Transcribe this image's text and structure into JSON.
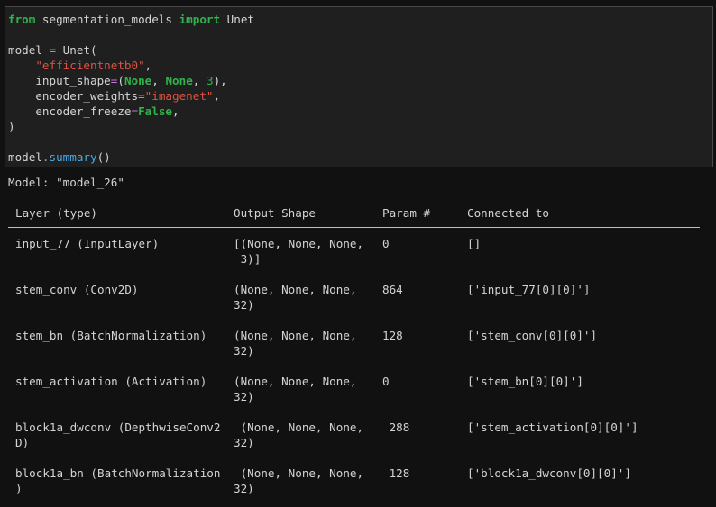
{
  "code": {
    "l1": {
      "kw1": "from",
      "mod": " segmentation_models ",
      "kw2": "import",
      "name": " Unet"
    },
    "l3": {
      "var": "model ",
      "eq": "=",
      "call": " Unet("
    },
    "l4": {
      "str": "\"efficientnetb0\"",
      "comma": ","
    },
    "l5": {
      "arg": "input_shape",
      "eq": "=",
      "p1": "(",
      "n1": "None",
      "c1": ", ",
      "n2": "None",
      "c2": ", ",
      "n3": "3",
      "p2": "),"
    },
    "l6": {
      "arg": "encoder_weights",
      "eq": "=",
      "str": "\"imagenet\"",
      "comma": ","
    },
    "l7": {
      "arg": "encoder_freeze",
      "eq": "=",
      "val": "False",
      "comma": ","
    },
    "l8": ")",
    "l10": {
      "obj": "model",
      "dot": ".",
      "fn": "summary",
      "paren": "()"
    }
  },
  "output": {
    "model_line": "Model: \"model_26\"",
    "headers": [
      "Layer (type)",
      "Output Shape",
      "Param #",
      "Connected to"
    ],
    "rows": [
      {
        "layer": [
          "input_77 (InputLayer)"
        ],
        "shape": [
          "[(None, None, None,",
          " 3)]"
        ],
        "param": "0",
        "conn": "[]"
      },
      {
        "layer": [
          "stem_conv (Conv2D)"
        ],
        "shape": [
          "(None, None, None,",
          "32)"
        ],
        "param": "864",
        "conn": "['input_77[0][0]']"
      },
      {
        "layer": [
          "stem_bn (BatchNormalization)"
        ],
        "shape": [
          "(None, None, None,",
          "32)"
        ],
        "param": "128",
        "conn": "['stem_conv[0][0]']"
      },
      {
        "layer": [
          "stem_activation (Activation)"
        ],
        "shape": [
          "(None, None, None,",
          "32)"
        ],
        "param": "0",
        "conn": "['stem_bn[0][0]']"
      },
      {
        "layer": [
          "block1a_dwconv (DepthwiseConv2",
          "D)"
        ],
        "shape": [
          " (None, None, None,",
          "32)"
        ],
        "param": " 288",
        "conn": "['stem_activation[0][0]']"
      },
      {
        "layer": [
          "block1a_bn (BatchNormalization",
          ")"
        ],
        "shape": [
          " (None, None, None,",
          "32)"
        ],
        "param": " 128",
        "conn": "['block1a_dwconv[0][0]']"
      }
    ]
  }
}
